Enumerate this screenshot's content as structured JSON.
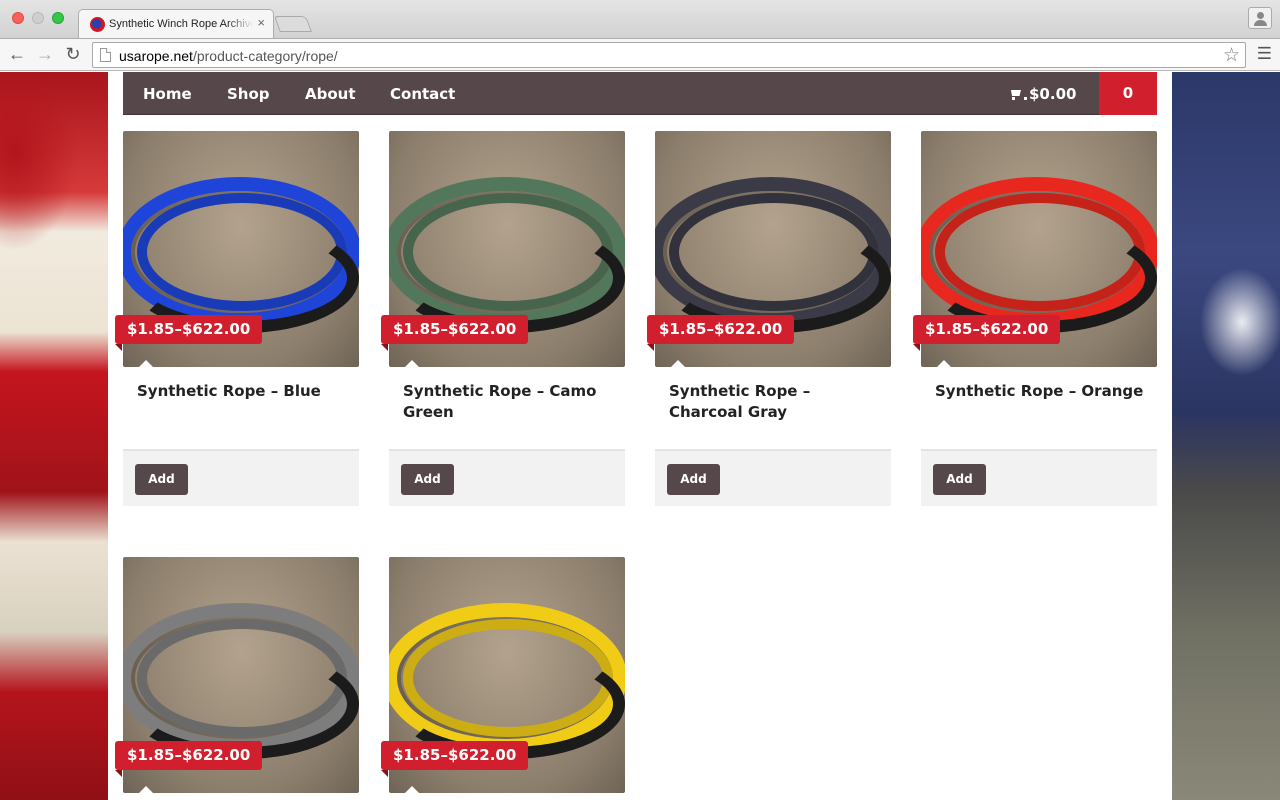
{
  "browser": {
    "tab_title": "Synthetic Winch Rope Archives",
    "tab_close": "×",
    "url_domain": "usarope.net",
    "url_path": "/product-category/rope/",
    "back": "←",
    "forward": "→",
    "reload": "↻",
    "star": "☆",
    "menu": "☰"
  },
  "nav": {
    "links": [
      "Home",
      "Shop",
      "About",
      "Contact"
    ],
    "cart_total": "$0.00",
    "cart_count": "0"
  },
  "colors": {
    "brand_red": "#d11f2d",
    "nav_bg": "#56474a"
  },
  "products": [
    {
      "name": "Synthetic Rope – Blue",
      "price": "$1.85–$622.00",
      "add": "Add",
      "color": "#1f45d8"
    },
    {
      "name": "Synthetic Rope – Camo Green",
      "price": "$1.85–$622.00",
      "add": "Add",
      "color": "#52775a"
    },
    {
      "name": "Synthetic Rope – Charcoal Gray",
      "price": "$1.85–$622.00",
      "add": "Add",
      "color": "#3a3b47"
    },
    {
      "name": "Synthetic Rope – Orange",
      "price": "$1.85–$622.00",
      "add": "Add",
      "color": "#e8281f"
    },
    {
      "name": "",
      "price": "$1.85–$622.00",
      "add": "",
      "color": "#7d7d7d"
    },
    {
      "name": "",
      "price": "$1.85–$622.00",
      "add": "",
      "color": "#f1cc17"
    }
  ]
}
